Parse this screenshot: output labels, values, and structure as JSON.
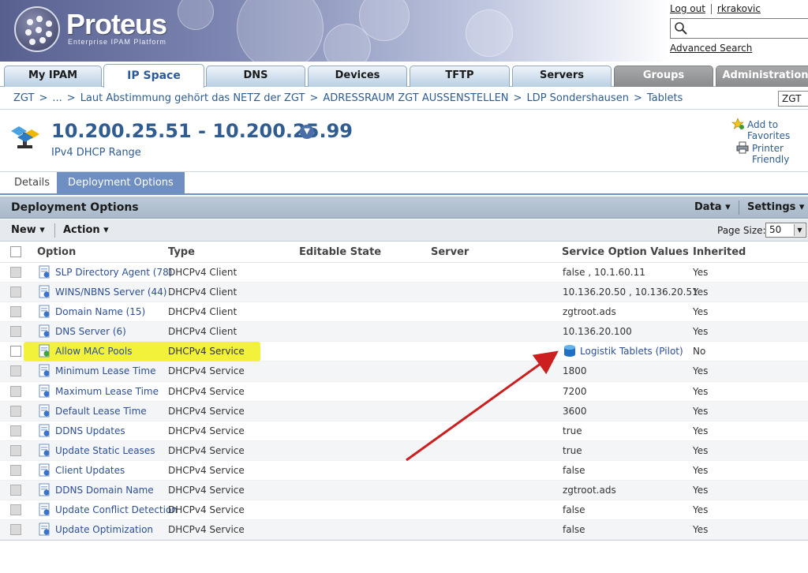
{
  "header": {
    "logo_text": "Proteus",
    "logo_subtitle": "Enterprise IPAM Platform",
    "logout_label": "Log out",
    "username": "rkrakovic",
    "search_placeholder": "",
    "advanced_search_label": "Advanced Search"
  },
  "tabs": [
    {
      "label": "My IPAM"
    },
    {
      "label": "IP Space"
    },
    {
      "label": "DNS"
    },
    {
      "label": "Devices"
    },
    {
      "label": "TFTP"
    },
    {
      "label": "Servers"
    },
    {
      "label": "Groups"
    },
    {
      "label": "Administration"
    }
  ],
  "breadcrumb": {
    "items": [
      "ZGT",
      "...",
      "Laut Abstimmung gehört das NETZ der ZGT",
      "ADRESSRAUM ZGT AUSSENSTELLEN",
      "LDP Sondershausen",
      "Tablets"
    ],
    "separator": ">",
    "selector_value": "ZGT"
  },
  "title": {
    "main": "10.200.25.51 - 10.200.25.99",
    "subtitle": "IPv4 DHCP Range",
    "add_favorites_label": "Add to Favorites",
    "printer_friendly_label": "Printer Friendly"
  },
  "subtabs": [
    {
      "label": "Details"
    },
    {
      "label": "Deployment Options"
    }
  ],
  "section": {
    "title": "Deployment Options",
    "data_menu": "Data",
    "settings_menu": "Settings"
  },
  "toolbar": {
    "new_label": "New",
    "action_label": "Action",
    "page_size_label": "Page Size:",
    "page_size_value": "50"
  },
  "table": {
    "columns": [
      "Option",
      "Type",
      "Editable State",
      "Server",
      "Service Option Values",
      "Inherited"
    ],
    "rows": [
      {
        "option": "SLP Directory Agent (78)",
        "type": "DHCPv4 Client",
        "value": "false , 10.1.60.11",
        "inherited": "Yes"
      },
      {
        "option": "WINS/NBNS Server (44)",
        "type": "DHCPv4 Client",
        "value": "10.136.20.50 , 10.136.20.51",
        "inherited": "Yes"
      },
      {
        "option": "Domain Name (15)",
        "type": "DHCPv4 Client",
        "value": "zgtroot.ads",
        "inherited": "Yes"
      },
      {
        "option": "DNS Server (6)",
        "type": "DHCPv4 Client",
        "value": "10.136.20.100",
        "inherited": "Yes"
      },
      {
        "option": "Allow MAC Pools",
        "type": "DHCPv4 Service",
        "value": "Logistik Tablets (Pilot)",
        "inherited": "No"
      },
      {
        "option": "Minimum Lease Time",
        "type": "DHCPv4 Service",
        "value": "1800",
        "inherited": "Yes"
      },
      {
        "option": "Maximum Lease Time",
        "type": "DHCPv4 Service",
        "value": "7200",
        "inherited": "Yes"
      },
      {
        "option": "Default Lease Time",
        "type": "DHCPv4 Service",
        "value": "3600",
        "inherited": "Yes"
      },
      {
        "option": "DDNS Updates",
        "type": "DHCPv4 Service",
        "value": "true",
        "inherited": "Yes"
      },
      {
        "option": "Update Static Leases",
        "type": "DHCPv4 Service",
        "value": "true",
        "inherited": "Yes"
      },
      {
        "option": "Client Updates",
        "type": "DHCPv4 Service",
        "value": "false",
        "inherited": "Yes"
      },
      {
        "option": "DDNS Domain Name",
        "type": "DHCPv4 Service",
        "value": "zgtroot.ads",
        "inherited": "Yes"
      },
      {
        "option": "Update Conflict Detection",
        "type": "DHCPv4 Service",
        "value": "false",
        "inherited": "Yes"
      },
      {
        "option": "Update Optimization",
        "type": "DHCPv4 Service",
        "value": "false",
        "inherited": "Yes"
      }
    ]
  },
  "colors": {
    "link_blue": "#2d4f95",
    "active_tab": "#6f8fc2",
    "highlight_yellow": "#f2f23a",
    "annotation_arrow": "#cc1f1f"
  }
}
